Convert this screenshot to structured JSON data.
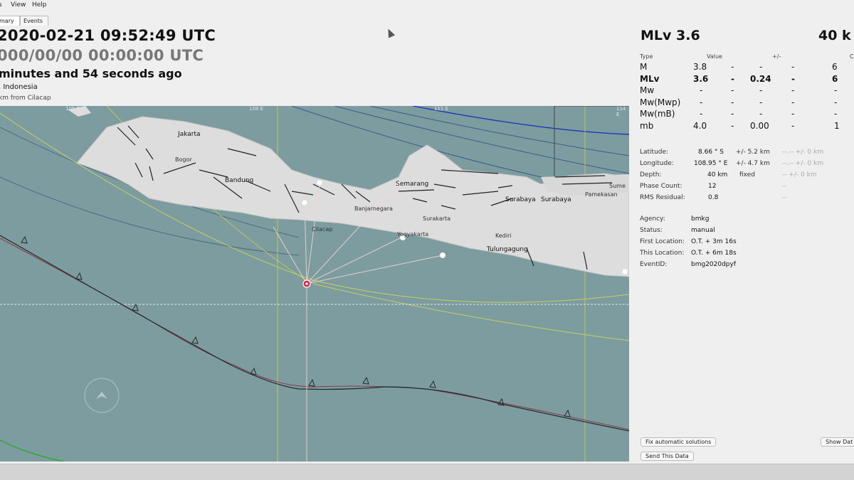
{
  "menu": {
    "file": "s",
    "view": "View",
    "help": "Help"
  },
  "tabs": [
    {
      "label": "mary"
    },
    {
      "label": "Events"
    }
  ],
  "header": {
    "origin_time": "2020-02-21 09:52:49 UTC",
    "zero_time": "000/00/00  00:00:00 UTC",
    "elapsed": "minutes and 54 seconds ago",
    "region": ", Indonesia",
    "distance": "km from Cilacap"
  },
  "map": {
    "tick_labels": [
      "105 E",
      "108 E",
      "111 E",
      "114 E"
    ],
    "cities": [
      {
        "name": "Jakarta"
      },
      {
        "name": "Bogor"
      },
      {
        "name": "Bandung"
      },
      {
        "name": "Cilacap"
      },
      {
        "name": "Banjarnegara"
      },
      {
        "name": "Semarang"
      },
      {
        "name": "Surakarta"
      },
      {
        "name": "Yogyakarta"
      },
      {
        "name": "Kediri"
      },
      {
        "name": "Tulungagung"
      },
      {
        "name": "Surabaya"
      },
      {
        "name": "Surabaya"
      },
      {
        "name": "Pamekasan"
      },
      {
        "name": "Sume"
      }
    ],
    "colors": {
      "sea": "#7d9ca0",
      "land": "#dddddd",
      "epicenter": "#e0203c"
    }
  },
  "summary": {
    "magnitude": "MLv 3.6",
    "depth": "40 k",
    "table_headers": {
      "type": "Type",
      "value": "Value",
      "pm": "+/-",
      "count": "C"
    },
    "magnitudes": [
      {
        "type": "M",
        "value": "3.8",
        "d1": "-",
        "pm": "-",
        "d2": "-",
        "count": "6",
        "bold": false
      },
      {
        "type": "MLv",
        "value": "3.6",
        "d1": "-",
        "pm": "0.24",
        "d2": "-",
        "count": "6",
        "bold": true
      },
      {
        "type": "Mw",
        "value": "-",
        "d1": "-",
        "pm": "-",
        "d2": "-",
        "count": "-",
        "bold": false
      },
      {
        "type": "Mw(Mwp)",
        "value": "-",
        "d1": "-",
        "pm": "-",
        "d2": "-",
        "count": "-",
        "bold": false
      },
      {
        "type": "Mw(mB)",
        "value": "-",
        "d1": "-",
        "pm": "-",
        "d2": "-",
        "count": "-",
        "bold": false
      },
      {
        "type": "mb",
        "value": "4.0",
        "d1": "-",
        "pm": "0.00",
        "d2": "-",
        "count": "1",
        "bold": false
      }
    ],
    "location": [
      {
        "label": "Latitude:",
        "value": "8.66 ° S",
        "unc": "+/- 5.2 km",
        "extra": "--.-- +/- 0 km"
      },
      {
        "label": "Longitude:",
        "value": "108.95 ° E",
        "unc": "+/- 4.7 km",
        "extra": "--.-- +/- 0 km"
      },
      {
        "label": "Depth:",
        "value": "40 km",
        "unc": "fixed",
        "extra": "-- +/- 0 km"
      },
      {
        "label": "Phase Count:",
        "value": "12",
        "unc": "",
        "extra": "--"
      },
      {
        "label": "RMS Residual:",
        "value": "0.8",
        "unc": "",
        "extra": "--"
      }
    ],
    "meta": [
      {
        "label": "Agency:",
        "value": "bmkg"
      },
      {
        "label": "Status:",
        "value": "manual"
      },
      {
        "label": "First Location:",
        "value": "O.T. + 3m 16s"
      },
      {
        "label": "This Location:",
        "value": "O.T. + 6m 18s"
      },
      {
        "label": "EventID:",
        "value": "bmg2020dpyf"
      }
    ],
    "buttons": {
      "fix_auto": "Fix automatic solutions",
      "send": "Send This Data",
      "show": "Show Dat"
    }
  }
}
